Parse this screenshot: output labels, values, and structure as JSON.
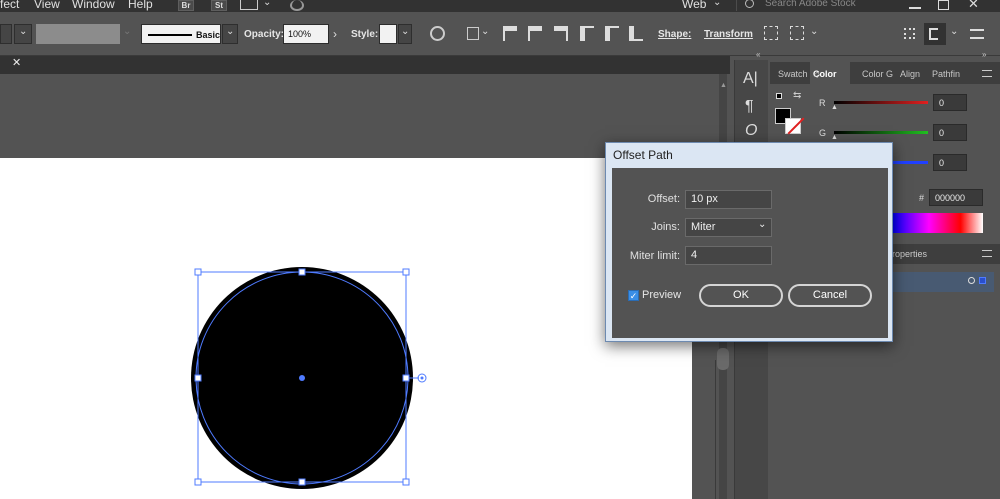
{
  "menubar": {
    "items": [
      "fect",
      "View",
      "Window",
      "Help"
    ],
    "bridge_label": "Br",
    "stock_label": "St",
    "workspace": "Web",
    "search_placeholder": "Search Adobe Stock"
  },
  "control_bar": {
    "brush_label": "Basic",
    "opacity_label": "Opacity:",
    "opacity_value": "100%",
    "style_label": "Style:",
    "shape_label": "Shape:",
    "transform_label": "Transform"
  },
  "panels": {
    "tabs": [
      "Swatch",
      "Color",
      "Color G",
      "Align",
      "Pathfin"
    ],
    "r_label": "R",
    "g_label": "G",
    "r_value": "0",
    "g_value": "0",
    "b_value": "0",
    "hex_symbol": "#",
    "hex_value": "000000",
    "properties_tab": "roperties",
    "colors": {
      "r": "#e02020",
      "g": "#20c020",
      "b": "#2040ff"
    }
  },
  "dialog": {
    "title": "Offset Path",
    "offset_label": "Offset:",
    "offset_value": "10 px",
    "joins_label": "Joins:",
    "joins_value": "Miter",
    "miter_label": "Miter limit:",
    "miter_value": "4",
    "preview_label": "Preview",
    "preview_checked": true,
    "ok_label": "OK",
    "cancel_label": "Cancel"
  }
}
